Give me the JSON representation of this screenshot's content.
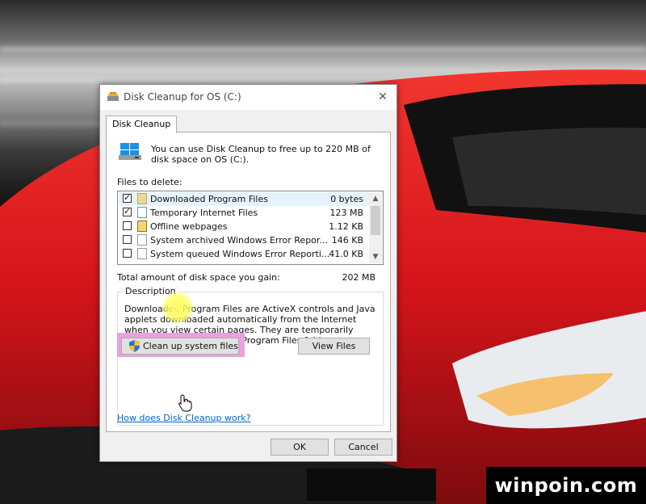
{
  "dialog": {
    "title": "Disk Cleanup for OS (C:)",
    "close_glyph": "✕",
    "tab_label": "Disk Cleanup",
    "intro_text": "You can use Disk Cleanup to free up to 220 MB of disk space on OS (C:).",
    "files_to_delete_label": "Files to delete:",
    "files": [
      {
        "checked": true,
        "name": "Downloaded Program Files",
        "size": "0 bytes",
        "icon": "folder-icon"
      },
      {
        "checked": true,
        "name": "Temporary Internet Files",
        "size": "123 MB",
        "icon": "document-icon"
      },
      {
        "checked": false,
        "name": "Offline webpages",
        "size": "1.12 KB",
        "icon": "webpage-icon"
      },
      {
        "checked": false,
        "name": "System archived Windows Error Repor...",
        "size": "146 KB",
        "icon": "file-icon"
      },
      {
        "checked": false,
        "name": "System queued Windows Error Reporti...",
        "size": "41.0 KB",
        "icon": "file-icon"
      }
    ],
    "total_label": "Total amount of disk space you gain:",
    "total_value": "202 MB",
    "description_title": "Description",
    "description_text": "Downloaded Program Files are ActiveX controls and Java applets downloaded automatically from the Internet when you view certain pages. They are temporarily stored in the Downloaded Program Files folder on your hard disk.",
    "cleanup_system_button": "Clean up system files",
    "view_files_button": "View Files",
    "help_link": "How does Disk Cleanup work?",
    "ok_button": "OK",
    "cancel_button": "Cancel"
  },
  "watermark": "winpoin.com",
  "colors": {
    "highlight_pink": "#e8a2dd",
    "cursor_highlight": "#ffff5a",
    "link_blue": "#0066cc",
    "car_red": "#d4141b"
  }
}
